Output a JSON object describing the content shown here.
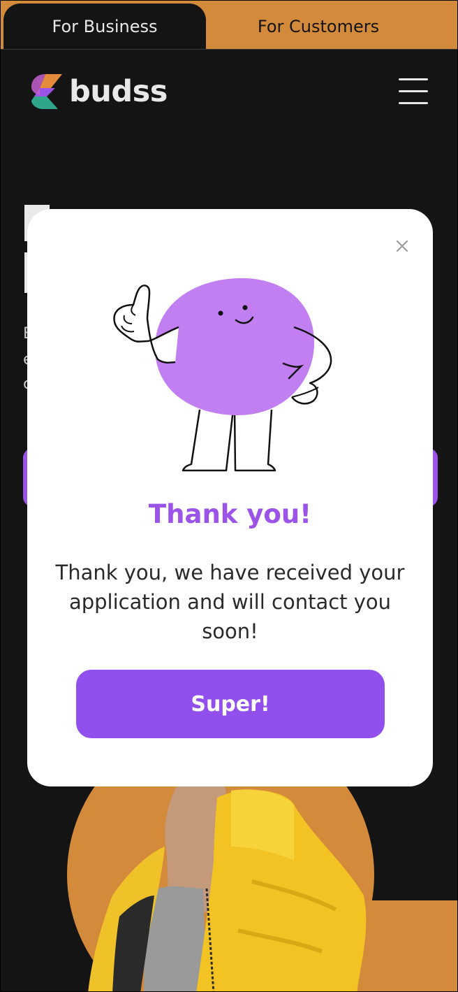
{
  "tabs": {
    "business_label": "For Business",
    "customers_label": "For Customers"
  },
  "header": {
    "logo_text": "budss",
    "menu_icon": "hamburger-menu-icon",
    "logo_icon": "budss-logo-icon"
  },
  "background": {
    "line_1": "E",
    "line_2": "e",
    "line_3": "c"
  },
  "modal": {
    "close_icon": "close-icon",
    "illustration": "thumbs-up-mascot-illustration",
    "title": "Thank you!",
    "message": "Thank you, we have received your application and will contact you soon!",
    "button_label": "Super!"
  },
  "colors": {
    "accent_purple": "#9150ed",
    "title_purple": "#9b54e7",
    "brand_orange": "#d48a3b",
    "background_dark": "#141414",
    "mascot_purple": "#c27ff1"
  }
}
